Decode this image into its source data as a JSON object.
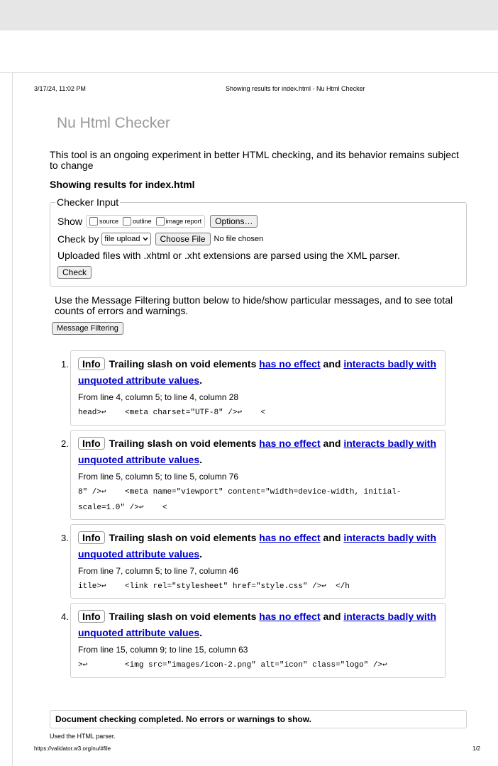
{
  "print_header": {
    "date": "3/17/24, 11:02 PM",
    "title": "Showing results for index.html - Nu Html Checker"
  },
  "brand": "Nu Html Checker",
  "intro": "This tool is an ongoing experiment in better HTML checking, and its behavior remains subject to change",
  "showing": "Showing results for index.html",
  "checker_input": {
    "legend": "Checker Input",
    "show_label": "Show",
    "options": {
      "source": "source",
      "outline": "outline",
      "image_report": "image report"
    },
    "options_button": "Options…",
    "check_by_label": "Check by",
    "check_by_value": "file upload",
    "choose_file": "Choose File",
    "no_file": "No file chosen",
    "upload_note": "Uploaded files with .xhtml or .xht extensions are parsed using the XML parser.",
    "check_button": "Check"
  },
  "filter_text": "Use the Message Filtering button below to hide/show particular messages, and to see total counts of errors and warnings.",
  "filter_button": "Message Filtering",
  "messages": [
    {
      "num": "1.",
      "type": "Info",
      "text": "Trailing slash on void elements",
      "link1": "has no effect",
      "and": "and",
      "link2a": "interacts badly with",
      "link2b": "unquoted attribute values",
      "period": ".",
      "location": "From line 4, column 5; to line 4, column 28",
      "code": "head>↩    <meta charset=\"UTF-8\" />↩    <"
    },
    {
      "num": "2.",
      "type": "Info",
      "text": "Trailing slash on void elements",
      "link1": "has no effect",
      "and": "and",
      "link2a": "interacts badly with",
      "link2b": "unquoted attribute values",
      "period": ".",
      "location": "From line 5, column 5; to line 5, column 76",
      "code": "8\" />↩    <meta name=\"viewport\" content=\"width=device-width, initial-\nscale=1.0\" />↩    <"
    },
    {
      "num": "3.",
      "type": "Info",
      "text": "Trailing slash on void elements",
      "link1": "has no effect",
      "and": "and",
      "link2a": "interacts badly with",
      "link2b": "unquoted attribute values",
      "period": ".",
      "location": "From line 7, column 5; to line 7, column 46",
      "code": "itle>↩    <link rel=\"stylesheet\" href=\"style.css\" />↩  </h"
    },
    {
      "num": "4.",
      "type": "Info",
      "text": "Trailing slash on void elements",
      "link1": "has no effect",
      "and": "and",
      "link2a": "interacts badly with",
      "link2b": "unquoted attribute values",
      "period": ".",
      "location": "From line 15, column 9; to line 15, column 63",
      "code": ">↩        <img src=\"images/icon-2.png\" alt=\"icon\" class=\"logo\" />↩"
    }
  ],
  "done": "Document checking completed. No errors or warnings to show.",
  "parser_note": "Used the HTML parser.",
  "footer": {
    "url": "https://validator.w3.org/nu/#file",
    "page": "1/2"
  }
}
